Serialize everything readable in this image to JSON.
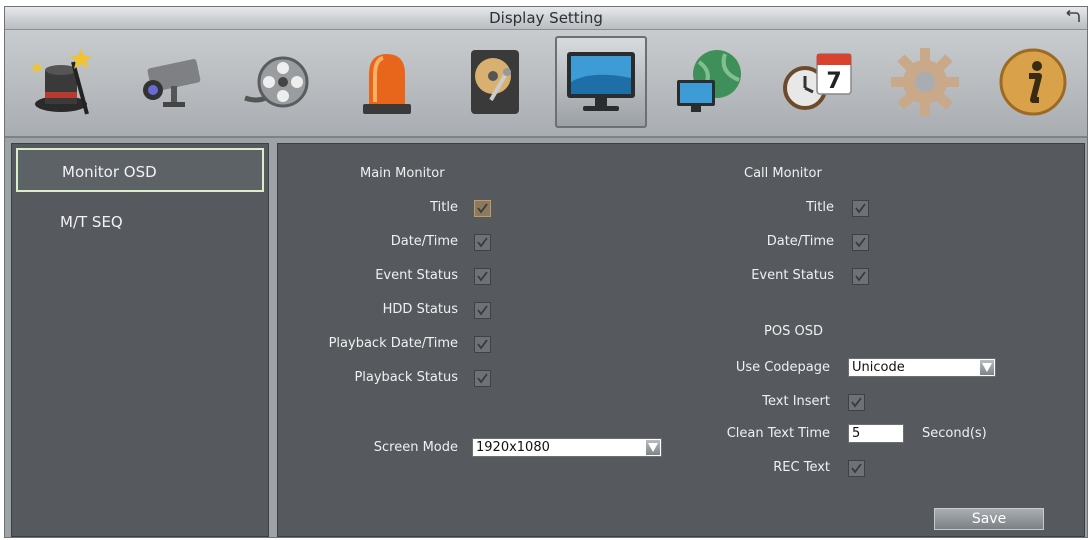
{
  "window": {
    "title": "Display Setting"
  },
  "toolbar": {
    "icons": [
      "wizard-hat-icon",
      "camera-icon",
      "film-reel-icon",
      "alarm-siren-icon",
      "hard-disk-icon",
      "monitor-icon",
      "network-globe-icon",
      "clock-calendar-icon",
      "gear-icon",
      "info-icon"
    ],
    "active": "monitor-icon",
    "calendar_day": "7"
  },
  "sidebar": {
    "items": [
      {
        "label": "Monitor OSD"
      },
      {
        "label": "M/T SEQ"
      }
    ],
    "selected": "Monitor OSD"
  },
  "main_monitor": {
    "heading": "Main Monitor",
    "title_label": "Title",
    "datetime_label": "Date/Time",
    "event_status_label": "Event Status",
    "hdd_status_label": "HDD Status",
    "playback_datetime_label": "Playback Date/Time",
    "playback_status_label": "Playback Status",
    "screen_mode_label": "Screen Mode",
    "screen_mode_value": "1920x1080"
  },
  "call_monitor": {
    "heading": "Call Monitor",
    "title_label": "Title",
    "datetime_label": "Date/Time",
    "event_status_label": "Event Status"
  },
  "pos_osd": {
    "heading": "POS OSD",
    "codepage_label": "Use Codepage",
    "codepage_value": "Unicode",
    "text_insert_label": "Text Insert",
    "clean_text_time_label": "Clean Text Time",
    "clean_text_time_value": "5",
    "clean_text_time_unit": "Second(s)",
    "rec_text_label": "REC Text"
  },
  "actions": {
    "save_label": "Save"
  },
  "colors": {
    "panel": "#565a5e",
    "selected_border": "#d9edc8",
    "highlight_checkbox": "#c79a5b"
  }
}
